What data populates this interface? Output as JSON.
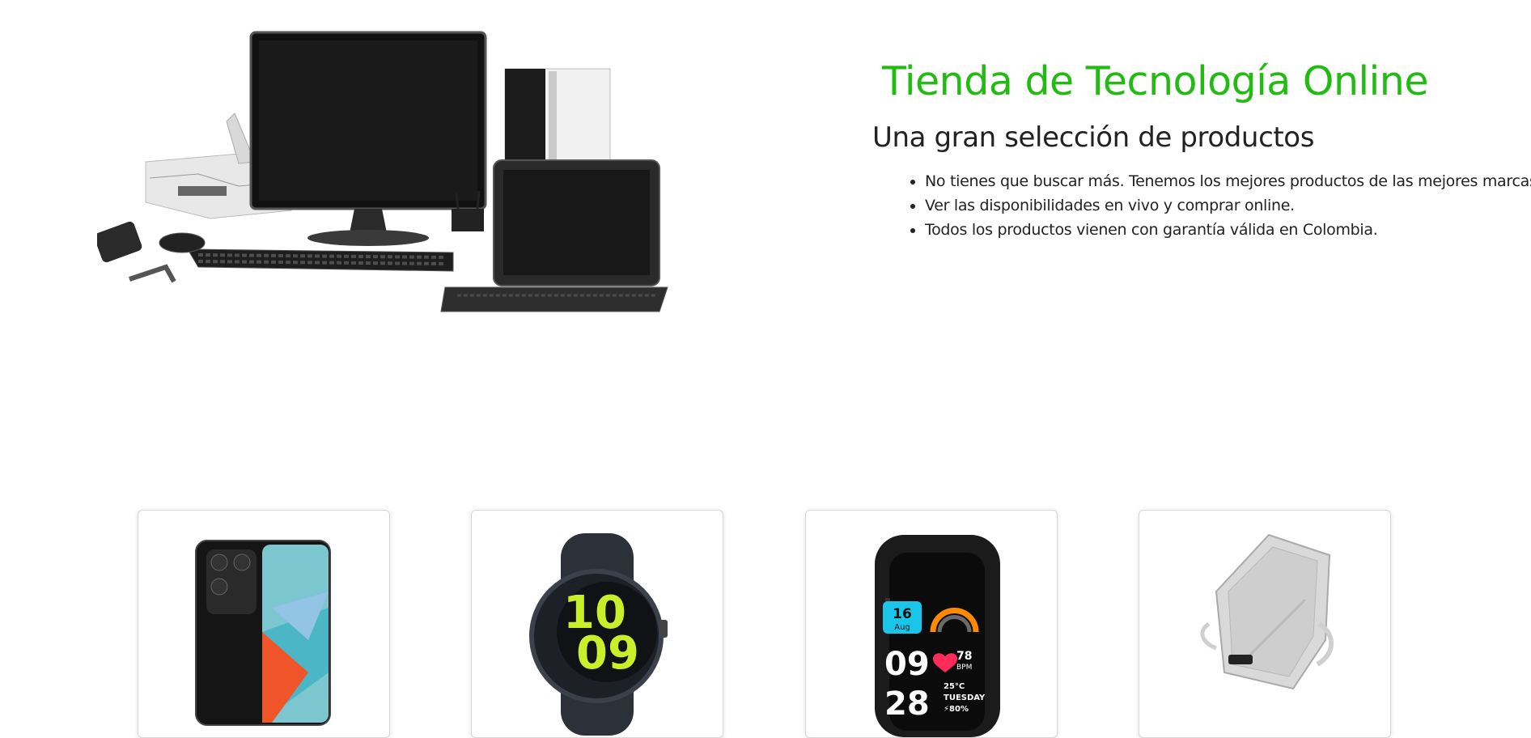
{
  "hero": {
    "title": "Tienda de Tecnología Online",
    "subtitle": "Una gran selección de productos",
    "features": [
      "No tienes que buscar más. Tenemos los mejores productos de las mejores marcas.",
      "Ver las disponibilidades en vivo y comprar online.",
      "Todos los productos vienen con garantía válida en Colombia."
    ],
    "image_icon": "computer-equipment-image"
  },
  "products": [
    {
      "icon": "smartphone-image"
    },
    {
      "icon": "smartwatch-round-image"
    },
    {
      "icon": "smartwatch-square-image",
      "watch_face": {
        "day": "16",
        "month": "Aug",
        "hour": "09",
        "minute": "28",
        "heart_rate": "78",
        "heart_unit": "BPM",
        "temperature": "25°C",
        "weekday": "TUESDAY",
        "battery": "⚡80%"
      }
    },
    {
      "icon": "power-bank-image"
    }
  ],
  "colors": {
    "title_green": "#22bb11",
    "text": "#222222",
    "card_border": "#d8d8d8"
  }
}
